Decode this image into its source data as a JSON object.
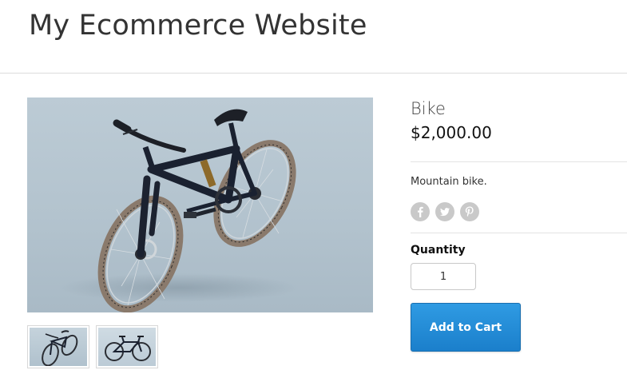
{
  "site": {
    "title": "My Ecommerce Website"
  },
  "product": {
    "name": "Bike",
    "price": "$2,000.00",
    "description": "Mountain bike.",
    "image_alt": "Mountain bike, three-quarter view",
    "thumbnails": [
      {
        "alt": "Mountain bike, angled view"
      },
      {
        "alt": "Mountain bike, side view"
      }
    ]
  },
  "share": [
    {
      "network": "Facebook",
      "icon": "facebook-icon"
    },
    {
      "network": "Twitter",
      "icon": "twitter-icon"
    },
    {
      "network": "Pinterest",
      "icon": "pinterest-icon"
    }
  ],
  "quantity": {
    "label": "Quantity",
    "value": "1"
  },
  "cart": {
    "add_label": "Add to Cart"
  },
  "colors": {
    "button": "#1f86d3",
    "social_icon": "#c9c9c9",
    "image_background": "#b7c6d1"
  }
}
